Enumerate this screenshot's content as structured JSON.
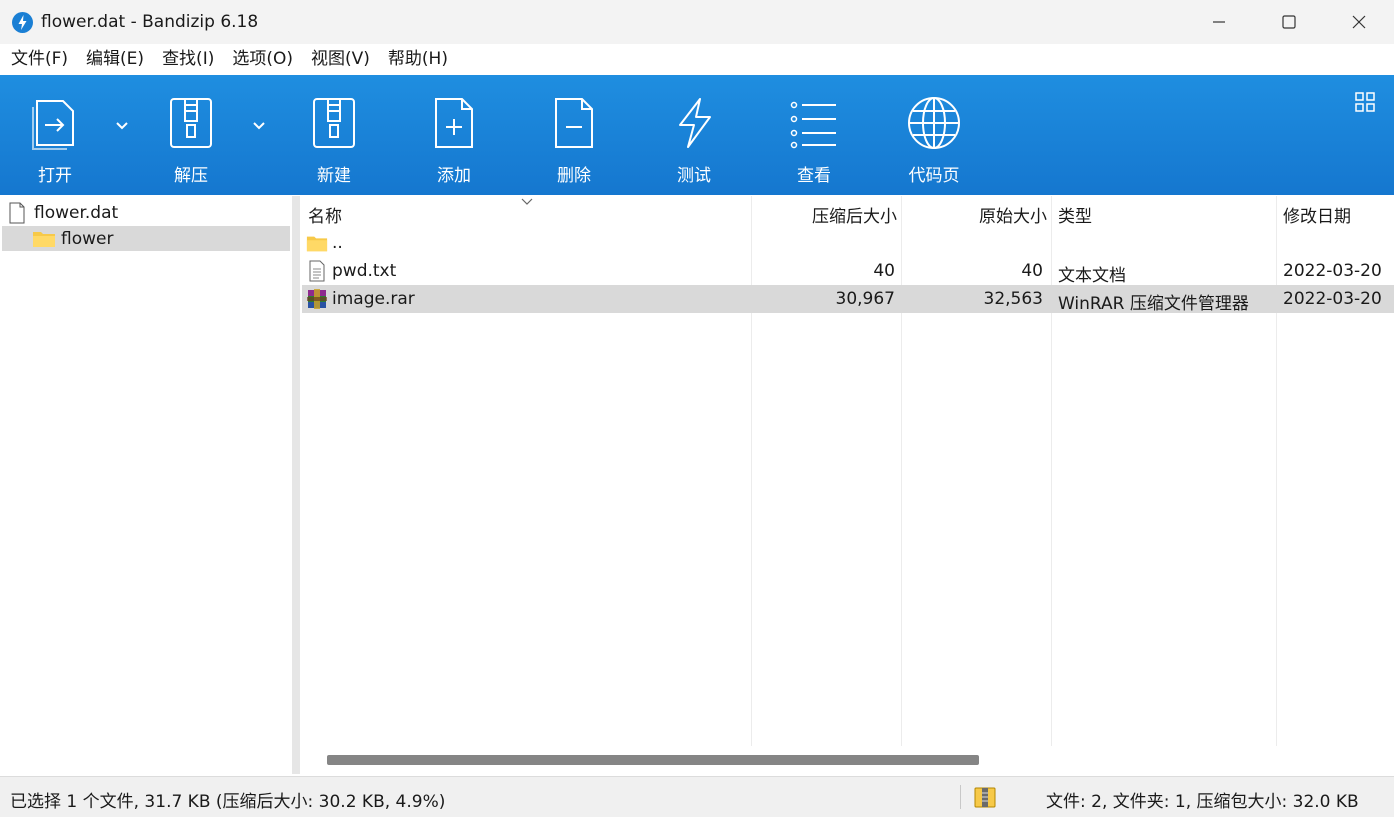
{
  "window": {
    "title": "flower.dat - Bandizip 6.18",
    "app_icon": "bandizip-logo-icon"
  },
  "menu": [
    "文件(F)",
    "编辑(E)",
    "查找(I)",
    "选项(O)",
    "视图(V)",
    "帮助(H)"
  ],
  "toolbar": {
    "accent": "#1a82d8",
    "open_label": "打开",
    "extract_label": "解压",
    "new_label": "新建",
    "add_label": "添加",
    "delete_label": "删除",
    "test_label": "测试",
    "view_label": "查看",
    "codepage_label": "代码页"
  },
  "tree": {
    "root": "flower.dat",
    "folder": "flower"
  },
  "columns": {
    "name": "名称",
    "packed": "压缩后大小",
    "size": "原始大小",
    "type": "类型",
    "modified": "修改日期"
  },
  "files": [
    {
      "name": "..",
      "packed": "",
      "size": "",
      "type": "",
      "modified": "",
      "icon": "folder-icon"
    },
    {
      "name": "pwd.txt",
      "packed": "40",
      "size": "40",
      "type": "文本文档",
      "modified": "2022-03-20",
      "icon": "text-file-icon"
    },
    {
      "name": "image.rar",
      "packed": "30,967",
      "size": "32,563",
      "type": "WinRAR 压缩文件管理器",
      "modified": "2022-03-20",
      "icon": "rar-archive-icon"
    }
  ],
  "status": {
    "left": "已选择 1 个文件, 31.7 KB (压缩后大小: 30.2 KB, 4.9%)",
    "right": "文件: 2, 文件夹: 1, 压缩包大小: 32.0 KB"
  }
}
